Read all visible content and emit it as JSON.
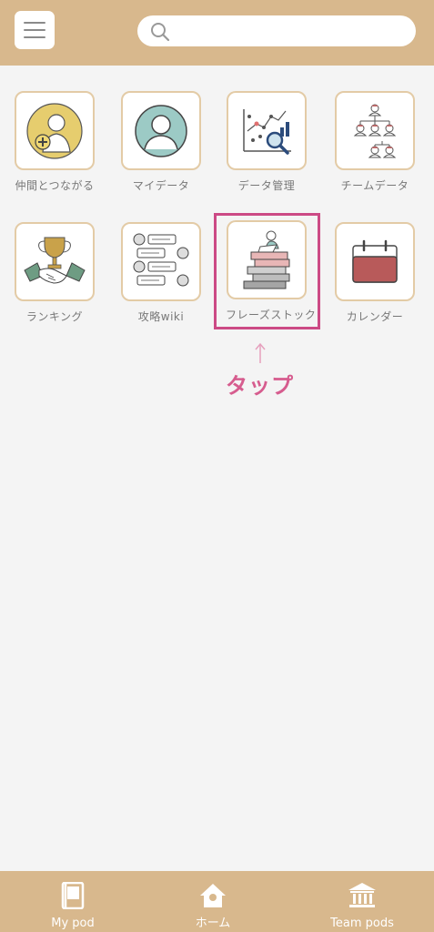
{
  "header": {
    "menu_icon": "hamburger-menu-icon",
    "search": {
      "placeholder": "",
      "icon": "search-icon"
    }
  },
  "tiles": [
    {
      "label": "仲間とつながる",
      "icon": "add-friend-icon"
    },
    {
      "label": "マイデータ",
      "icon": "profile-icon"
    },
    {
      "label": "データ管理",
      "icon": "data-analysis-icon"
    },
    {
      "label": "チームデータ",
      "icon": "team-hierarchy-icon"
    },
    {
      "label": "ランキング",
      "icon": "trophy-handshake-icon"
    },
    {
      "label": "攻略wiki",
      "icon": "chat-list-icon"
    },
    {
      "label": "フレーズストック",
      "icon": "book-stack-icon"
    },
    {
      "label": "カレンダー",
      "icon": "calendar-icon"
    }
  ],
  "annotation": {
    "tap_text": "タップ",
    "color": "#cc4a85"
  },
  "bottom_nav": [
    {
      "label": "My pod",
      "icon": "notebook-icon"
    },
    {
      "label": "ホーム",
      "icon": "home-icon"
    },
    {
      "label": "Team pods",
      "icon": "building-icon"
    }
  ],
  "colors": {
    "header": "#d8b88d",
    "tile_border": "#e3cba6",
    "background": "#f4f4f4"
  }
}
